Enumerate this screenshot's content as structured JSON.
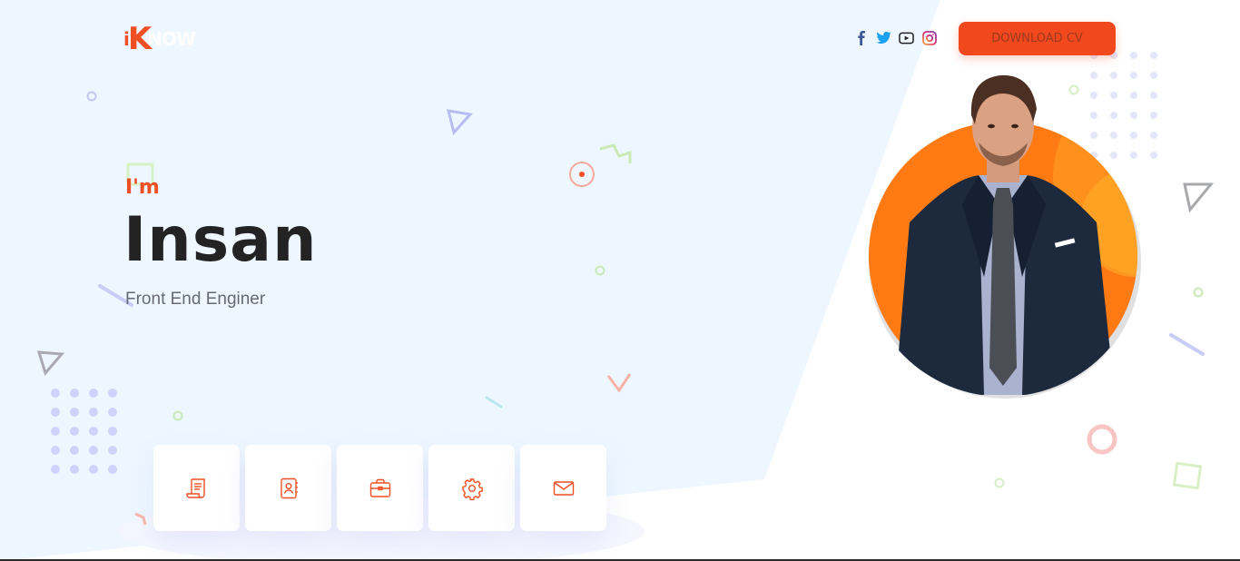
{
  "logo": {
    "i": "i",
    "k": "K",
    "rest": "NOW"
  },
  "header": {
    "socials": [
      {
        "name": "facebook-icon",
        "color": "#3b5998"
      },
      {
        "name": "twitter-icon",
        "color": "#1da1f2"
      },
      {
        "name": "youtube-icon",
        "color": "#222222"
      },
      {
        "name": "instagram-icon",
        "color": "#e1306c"
      }
    ],
    "cv_button_label": "DOWNLOAD CV"
  },
  "hero": {
    "greeting": "I'm",
    "name": "Insan",
    "role": "Front End Enginer"
  },
  "nav_cards": [
    {
      "icon": "resume-scroll-icon"
    },
    {
      "icon": "contact-book-icon"
    },
    {
      "icon": "briefcase-icon"
    },
    {
      "icon": "gear-icon"
    },
    {
      "icon": "envelope-icon"
    }
  ],
  "colors": {
    "accent": "#f04e23",
    "background_panel": "#eef7ff",
    "portrait_circle": "#ff7a12"
  }
}
